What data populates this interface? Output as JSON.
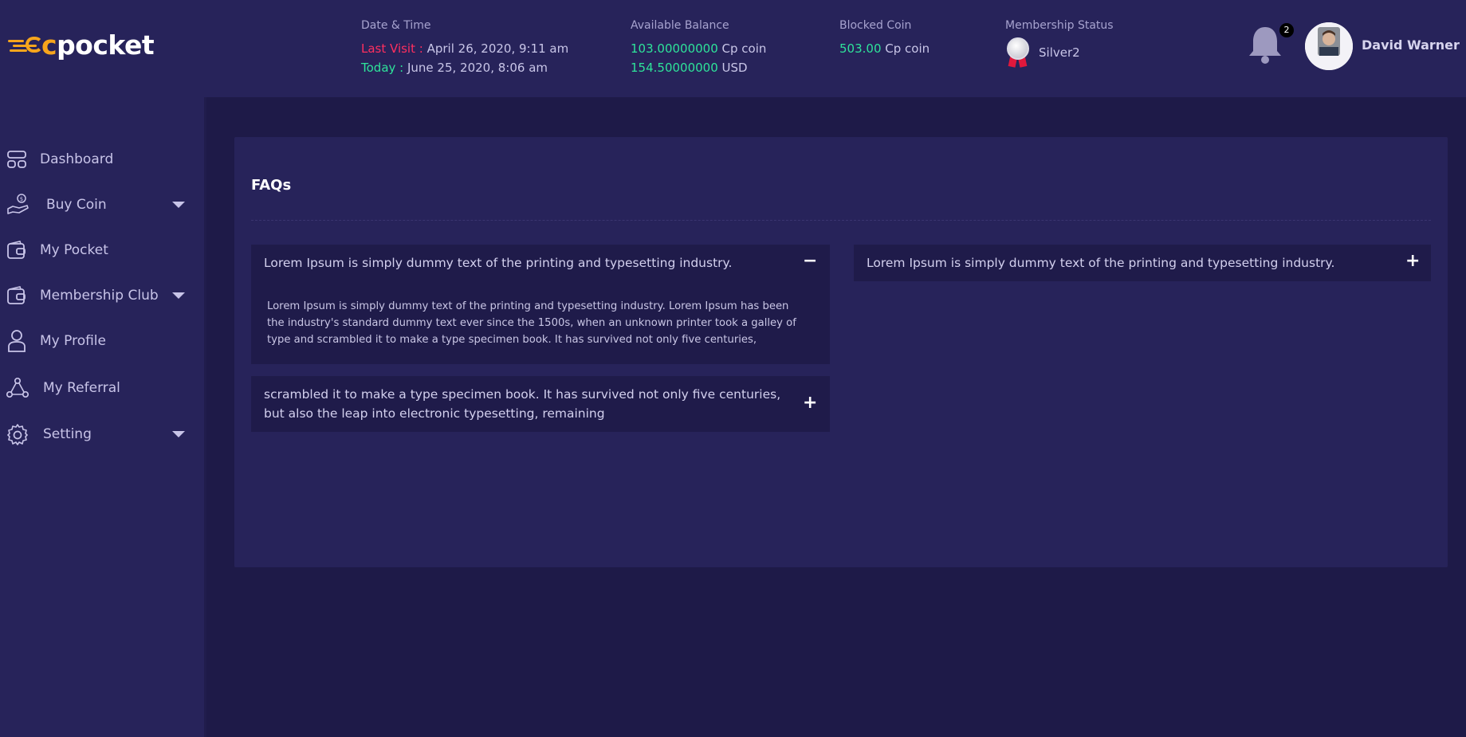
{
  "brand": {
    "logo_c": "c",
    "logo_rest": "pocket"
  },
  "header": {
    "datetime": {
      "label": "Date & Time",
      "last_visit_label": "Last Visit :",
      "last_visit_value": "April 26, 2020, 9:11 am",
      "today_label": "Today :",
      "today_value": "June 25, 2020, 8:06 am"
    },
    "balance": {
      "label": "Available Balance",
      "coin_amount": "103.00000000",
      "coin_unit": "Cp coin",
      "usd_amount": "154.50000000",
      "usd_unit": "USD"
    },
    "blocked": {
      "label": "Blocked Coin",
      "amount": "503.00",
      "unit": "Cp coin"
    },
    "membership": {
      "label": "Membership Status",
      "value": "Silver2"
    },
    "notifications": {
      "count": "2"
    },
    "user": {
      "name": "David Warner"
    }
  },
  "sidebar": {
    "items": [
      {
        "label": "Dashboard",
        "icon": "dashboard-icon"
      },
      {
        "label": "Buy Coin",
        "icon": "buy-coin-icon"
      },
      {
        "label": "My Pocket",
        "icon": "wallet-icon"
      },
      {
        "label": "Membership Club",
        "icon": "membership-icon"
      },
      {
        "label": "My Profile",
        "icon": "profile-icon"
      },
      {
        "label": "My Referral",
        "icon": "referral-icon"
      },
      {
        "label": "Setting",
        "icon": "gear-icon"
      }
    ]
  },
  "faq": {
    "title": "FAQs",
    "items": [
      {
        "question": "Lorem Ipsum is simply dummy text of the printing and typesetting industry.",
        "answer": "Lorem Ipsum is simply dummy text of the printing and typesetting industry. Lorem Ipsum has been the industry's standard dummy text ever since the 1500s, when an unknown printer took a galley of type and scrambled it to make a type specimen book. It has survived not only five centuries,",
        "toggle": "−"
      },
      {
        "question": "scrambled it to make a type specimen book. It has survived not only five centuries, but also the leap into electronic typesetting, remaining",
        "toggle": "+"
      },
      {
        "question": "Lorem Ipsum is simply dummy text of the printing and typesetting industry.",
        "toggle": "+"
      }
    ]
  },
  "colors": {
    "background": "#1e1a48",
    "panel": "#27235a",
    "accent_orange": "#f7a51c",
    "accent_green": "#2ee39a",
    "accent_red": "#ff2f5f"
  }
}
